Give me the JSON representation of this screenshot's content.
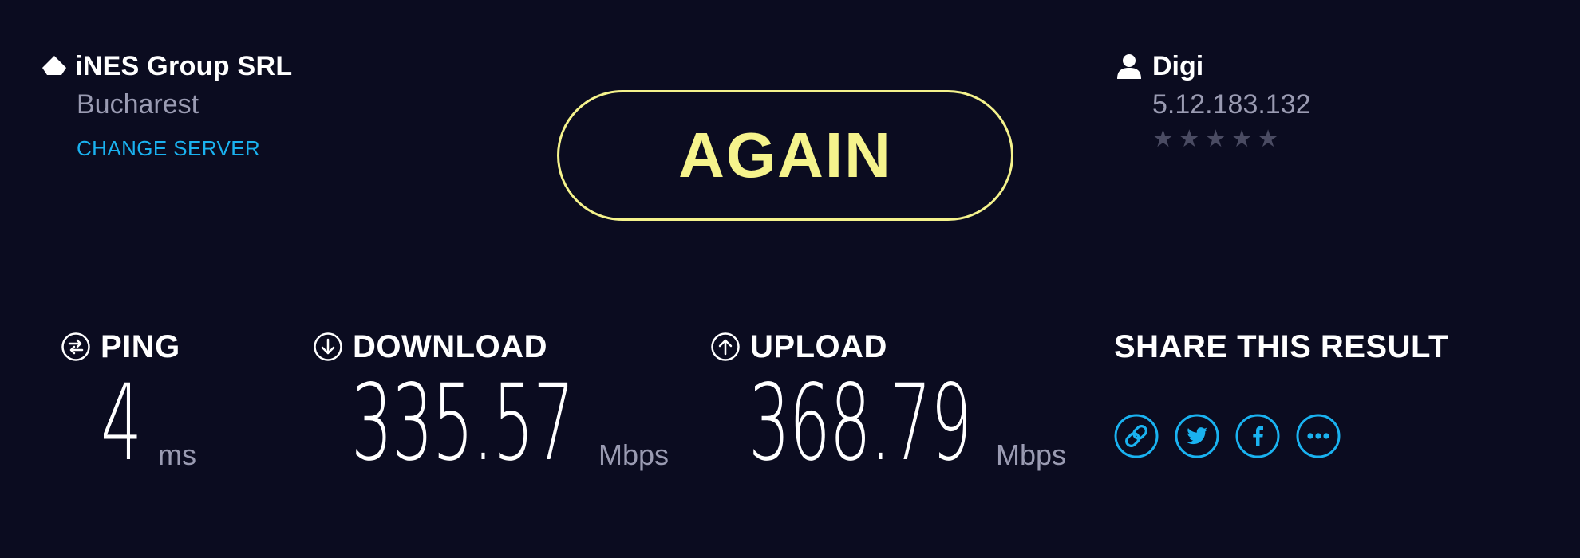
{
  "server": {
    "name": "iNES Group SRL",
    "city": "Bucharest",
    "change_label": "CHANGE SERVER"
  },
  "again_button": {
    "label": "AGAIN"
  },
  "isp": {
    "name": "Digi",
    "ip": "5.12.183.132",
    "rating": {
      "stars_total": 5,
      "stars_filled": 0
    }
  },
  "metrics": {
    "ping": {
      "label": "PING",
      "value": "4",
      "unit": "ms"
    },
    "download": {
      "label": "DOWNLOAD",
      "value": "335.57",
      "unit": "Mbps"
    },
    "upload": {
      "label": "UPLOAD",
      "value": "368.79",
      "unit": "Mbps"
    }
  },
  "share": {
    "title": "SHARE THIS RESULT",
    "icons": [
      "link-icon",
      "twitter-icon",
      "facebook-icon",
      "more-icon"
    ]
  },
  "colors": {
    "background": "#0b0c20",
    "accent_yellow": "#f5f38c",
    "accent_blue": "#1ab2f0",
    "muted_text": "#9a9bb2",
    "star_inactive": "#4a4b62"
  },
  "icons": {
    "server": "server-pin-icon",
    "isp": "user-icon",
    "ping": "ping-icon",
    "download": "download-arrow-icon",
    "upload": "upload-arrow-icon"
  }
}
